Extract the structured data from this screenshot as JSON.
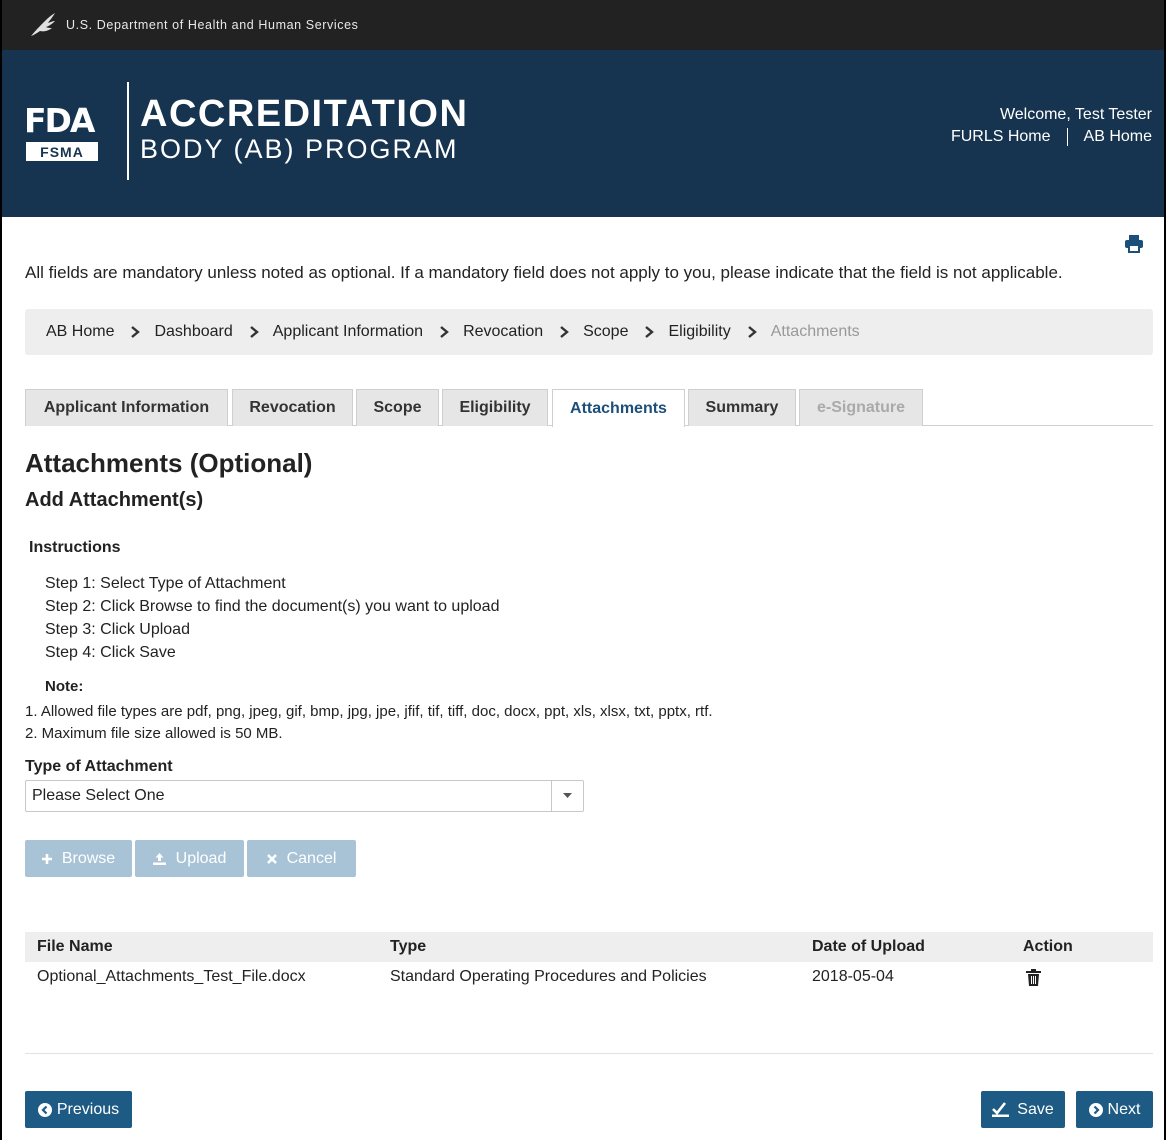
{
  "top_bar": {
    "agency": "U.S. Department of Health and Human Services",
    "icon": "hhs-eagle-icon"
  },
  "header": {
    "logo_text": "FDA",
    "logo_sub": "FSMA",
    "title_line1": "ACCREDITATION",
    "title_line2": "BODY (AB) PROGRAM",
    "welcome": "Welcome, Test Tester",
    "links": [
      "FURLS Home",
      "AB Home"
    ],
    "background_color": "#16344f"
  },
  "intro_text": "All fields are mandatory unless noted as optional. If a mandatory field does not apply to you, please indicate that the field is not applicable.",
  "breadcrumb": [
    "AB Home",
    "Dashboard",
    "Applicant Information",
    "Revocation",
    "Scope",
    "Eligibility",
    "Attachments"
  ],
  "tabs": [
    {
      "label": "Applicant Information",
      "state": "normal"
    },
    {
      "label": "Revocation",
      "state": "normal"
    },
    {
      "label": "Scope",
      "state": "normal"
    },
    {
      "label": "Eligibility",
      "state": "normal"
    },
    {
      "label": "Attachments",
      "state": "active"
    },
    {
      "label": "Summary",
      "state": "normal"
    },
    {
      "label": "e-Signature",
      "state": "disabled"
    }
  ],
  "page_title": "Attachments (Optional)",
  "section_title": "Add Attachment(s)",
  "instructions": {
    "title": "Instructions",
    "steps": [
      "Step 1: Select Type of Attachment",
      "Step 2: Click Browse to find the document(s) you want to upload",
      "Step 3: Click Upload",
      "Step 4: Click Save"
    ],
    "note_title": "Note:",
    "notes": [
      "1. Allowed file types are pdf, png, jpeg, gif, bmp, jpg, jpe, jfif, tif, tiff, doc, docx, ppt, xls, xlsx, txt, pptx, rtf.",
      "2. Maximum file size allowed is 50 MB."
    ]
  },
  "attachment_type": {
    "label": "Type of Attachment",
    "selected": "Please Select One"
  },
  "upload_buttons": {
    "browse": "Browse",
    "upload": "Upload",
    "cancel": "Cancel"
  },
  "table": {
    "headers": [
      "File Name",
      "Type",
      "Date of Upload",
      "Action"
    ],
    "rows": [
      {
        "file_name": "Optional_Attachments_Test_File.docx",
        "type": "Standard Operating Procedures and Policies",
        "date": "2018-05-04",
        "action_icon": "trash-icon"
      }
    ]
  },
  "footer": {
    "previous": "Previous",
    "save": "Save",
    "next": "Next"
  },
  "colors": {
    "primary_button": "#1d5a84",
    "disabled_button": "#a9c3d6",
    "active_tab_text": "#1d4f7b"
  }
}
